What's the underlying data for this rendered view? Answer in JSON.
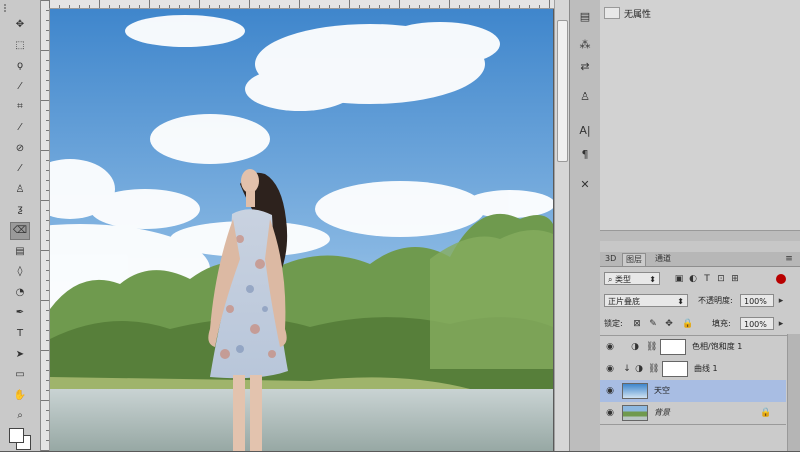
{
  "tools": [
    {
      "name": "move-tool-icon",
      "glyph": "✥"
    },
    {
      "name": "marquee-tool-icon",
      "glyph": "⬚"
    },
    {
      "name": "lasso-tool-icon",
      "glyph": "ϙ"
    },
    {
      "name": "quick-select-tool-icon",
      "glyph": "⁄"
    },
    {
      "name": "crop-tool-icon",
      "glyph": "⌗"
    },
    {
      "name": "eyedropper-tool-icon",
      "glyph": "⁄"
    },
    {
      "name": "healing-brush-tool-icon",
      "glyph": "⊘"
    },
    {
      "name": "brush-tool-icon",
      "glyph": "⁄"
    },
    {
      "name": "clone-stamp-tool-icon",
      "glyph": "♙"
    },
    {
      "name": "history-brush-tool-icon",
      "glyph": "ƺ"
    },
    {
      "name": "eraser-tool-icon",
      "glyph": "⌫"
    },
    {
      "name": "gradient-tool-icon",
      "glyph": "▤"
    },
    {
      "name": "blur-tool-icon",
      "glyph": "◊"
    },
    {
      "name": "dodge-tool-icon",
      "glyph": "◔"
    },
    {
      "name": "pen-tool-icon",
      "glyph": "✒"
    },
    {
      "name": "type-tool-icon",
      "glyph": "T"
    },
    {
      "name": "path-select-tool-icon",
      "glyph": "➤"
    },
    {
      "name": "shape-tool-icon",
      "glyph": "▭"
    },
    {
      "name": "hand-tool-icon",
      "glyph": "✋"
    },
    {
      "name": "zoom-tool-icon",
      "glyph": "⌕"
    }
  ],
  "strip_icons": [
    {
      "name": "history-panel-icon",
      "glyph": "▤"
    },
    {
      "name": "brush-preset-icon",
      "glyph": "⁂"
    },
    {
      "name": "adjustments-icon",
      "glyph": "⇄"
    },
    {
      "name": "clone-source-icon",
      "glyph": "♙"
    },
    {
      "name": "character-icon",
      "glyph": "A|"
    },
    {
      "name": "paragraph-icon",
      "glyph": "¶"
    },
    {
      "name": "tool-presets-icon",
      "glyph": "✕"
    }
  ],
  "history": {
    "state_label": "无属性"
  },
  "layers_panel": {
    "tabs": [
      "3D",
      "图层",
      "通道"
    ],
    "filter_kind": "类型",
    "blend_mode": "正片叠底",
    "opacity_label": "不透明度:",
    "opacity_value": "100%",
    "lock_label": "锁定:",
    "fill_label": "填充:",
    "fill_value": "100%",
    "layers": [
      {
        "name": "色相/饱和度 1",
        "kind": "adjustment-hue"
      },
      {
        "name": "曲线 1",
        "kind": "adjustment-curves"
      },
      {
        "name": "天空",
        "kind": "image-sky",
        "selected": true
      },
      {
        "name": "背景",
        "kind": "image-bg",
        "locked": true
      }
    ]
  },
  "colors": {
    "selection": "#a8bde3",
    "sky_top": "#4d8fcf",
    "sky_bottom": "#b8d4ec"
  }
}
